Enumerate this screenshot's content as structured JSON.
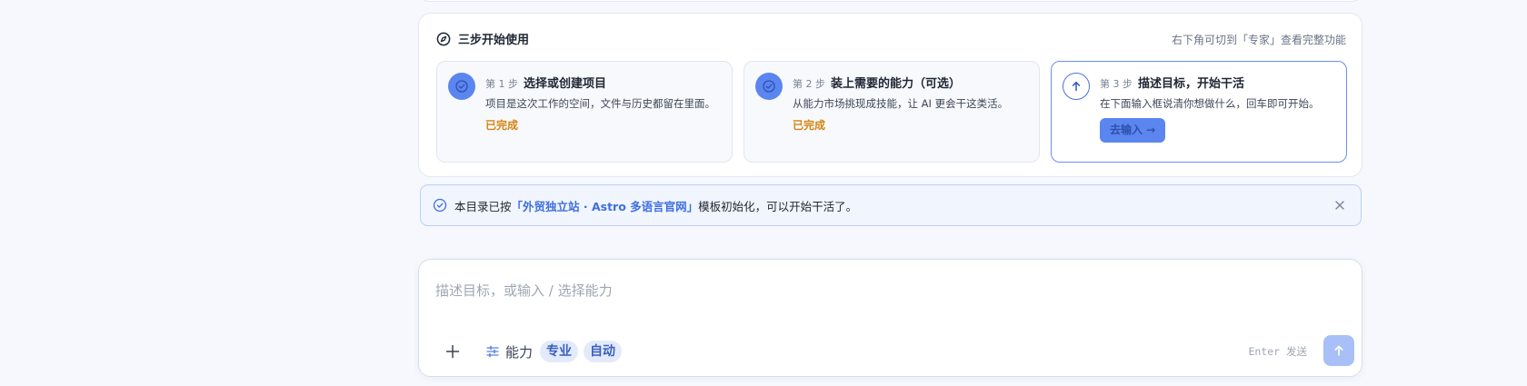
{
  "onboarding": {
    "title": "三步开始使用",
    "hint": "右下角可切到「专家」查看完整功能",
    "steps": [
      {
        "num": "第 1 步",
        "name": "选择或创建项目",
        "desc": "项目是这次工作的空间，文件与历史都留在里面。",
        "status": "已完成",
        "icon": "check-circle-icon"
      },
      {
        "num": "第 2 步",
        "name": "装上需要的能力（可选）",
        "desc": "从能力市场挑现成技能，让 AI 更会干这类活。",
        "status": "已完成",
        "icon": "check-circle-icon"
      },
      {
        "num": "第 3 步",
        "name": "描述目标，开始干活",
        "desc": "在下面输入框说清你想做什么，回车即可开始。",
        "action": "去输入 →",
        "icon": "arrow-up-circle-icon"
      }
    ]
  },
  "notice": {
    "prefix": "本目录已按",
    "highlight": "「外贸独立站 · Astro 多语言官网」",
    "suffix": "模板初始化，可以开始干活了。"
  },
  "composer": {
    "placeholder": "描述目标，或输入 / 选择能力",
    "value": "",
    "capability_label": "能力",
    "chips": [
      "专业",
      "自动"
    ],
    "enter_hint": "Enter 发送"
  },
  "colors": {
    "accent": "#5b86f0",
    "done_status": "#d68412",
    "highlight_text": "#3e6fe0",
    "send_button": "#a8c0f7"
  }
}
